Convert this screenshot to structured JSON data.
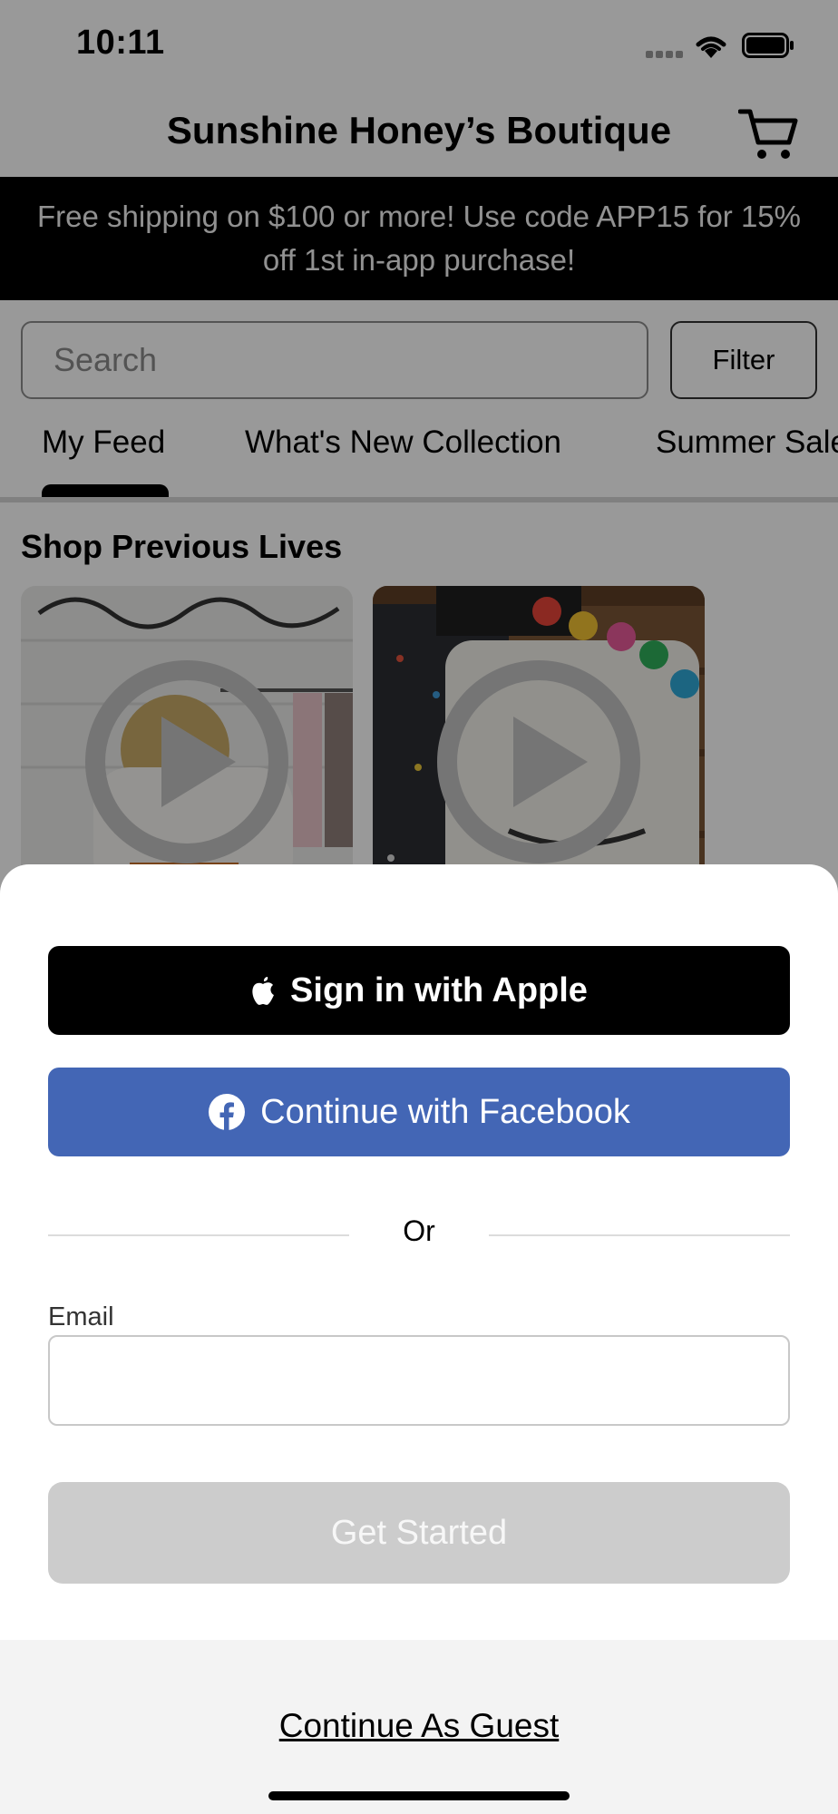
{
  "status_bar": {
    "time": "10:11"
  },
  "header": {
    "title": "Sunshine Honey’s Boutique",
    "cart_icon": "cart-icon"
  },
  "promo_banner": {
    "text": "Free shipping on $100 or more! Use code APP15 for 15% off 1st in-app purchase!"
  },
  "search": {
    "placeholder": "Search",
    "value": ""
  },
  "filter_button": {
    "label": "Filter"
  },
  "tabs": [
    {
      "label": "My Feed",
      "selected": true
    },
    {
      "label": "What's New Collection",
      "selected": false
    },
    {
      "label": "Summer Sale",
      "selected": false
    }
  ],
  "previous_lives": {
    "title": "Shop Previous Lives",
    "videos": [
      {
        "thumbnail": "boutique-sweatshirt-video-thumbnail",
        "play_icon": "play-icon"
      },
      {
        "thumbnail": "graphic-tee-video-thumbnail",
        "play_icon": "play-icon"
      }
    ]
  },
  "login_sheet": {
    "apple_button": "Sign in with Apple",
    "facebook_button": "Continue with Facebook",
    "divider_text": "Or",
    "email_label": "Email",
    "email_value": "",
    "get_started_button": "Get Started",
    "guest_link": "Continue As Guest"
  },
  "colors": {
    "facebook_blue": "#4366b5",
    "apple_black": "#000000",
    "disabled_button": "#cccccc",
    "promo_background": "#000000",
    "scrim": "rgba(0,0,0,0.4)"
  }
}
